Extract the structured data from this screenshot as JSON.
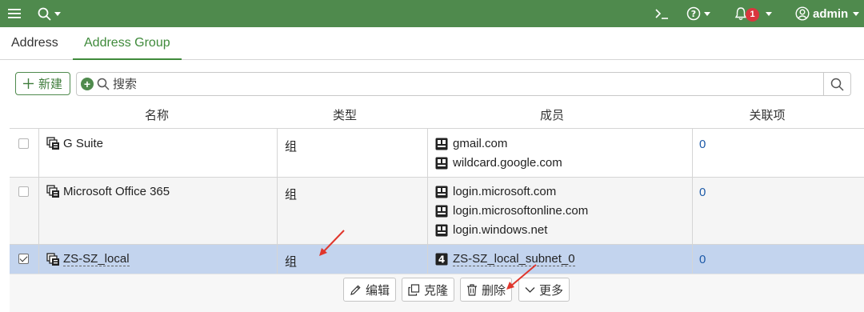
{
  "topbar": {
    "menu_icon": "hamburger-icon",
    "search_icon": "search-icon",
    "terminal_icon": "terminal-icon",
    "help_icon": "help-icon",
    "bell_icon": "bell-icon",
    "notification_count": "1",
    "user_icon": "user-icon",
    "username": "admin",
    "bar_color": "#4f8a4d"
  },
  "tabs": [
    {
      "label": "Address",
      "active": false
    },
    {
      "label": "Address Group",
      "active": true
    }
  ],
  "toolbar": {
    "new_label": "新建",
    "search_placeholder": "搜索"
  },
  "table": {
    "columns": [
      "名称",
      "类型",
      "成员",
      "关联项"
    ],
    "rows": [
      {
        "checked": false,
        "name": "G Suite",
        "type": "组",
        "members": [
          "gmail.com",
          "wildcard.google.com"
        ],
        "references": "0"
      },
      {
        "checked": false,
        "name": "Microsoft Office 365",
        "type": "组",
        "members": [
          "login.microsoft.com",
          "login.microsoftonline.com",
          "login.windows.net"
        ],
        "references": "0"
      },
      {
        "checked": true,
        "name": "ZS-SZ_local",
        "type": "组",
        "members": [
          "ZS-SZ_local_subnet_0"
        ],
        "references": "0"
      }
    ]
  },
  "actions": {
    "edit": "编辑",
    "clone": "克隆",
    "delete": "删除",
    "more": "更多"
  },
  "colors": {
    "accent": "#3f8a3b",
    "selected_row": "#c3d4ee",
    "link": "#1d5aa8",
    "annotation_arrow": "#e0362c"
  }
}
